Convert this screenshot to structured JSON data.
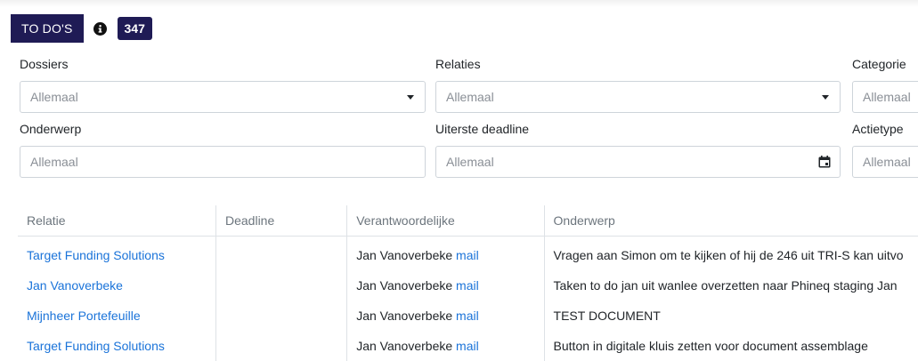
{
  "header": {
    "tab_label": "TO DO'S",
    "info_icon": "info-circle-icon",
    "count": "347",
    "accent": "#1f1b55"
  },
  "filters": {
    "dossiers": {
      "label": "Dossiers",
      "value": "Allemaal"
    },
    "relaties": {
      "label": "Relaties",
      "value": "Allemaal"
    },
    "categorie": {
      "label": "Categorie",
      "value": "Allemaal"
    },
    "onderwerp": {
      "label": "Onderwerp",
      "value": "Allemaal"
    },
    "uiterste_deadline": {
      "label": "Uiterste deadline",
      "value": "Allemaal"
    },
    "actietype": {
      "label": "Actietype",
      "value": "Allemaal"
    }
  },
  "table": {
    "columns": [
      "Relatie",
      "Deadline",
      "Verantwoordelijke",
      "Onderwerp"
    ],
    "rows": [
      {
        "relatie": "Target Funding Solutions",
        "deadline": "",
        "verantwoordelijke": "Jan Vanoverbeke",
        "mail": "mail",
        "onderwerp": "Vragen aan Simon om te kijken of hij de 246 uit TRI-S kan uitvo"
      },
      {
        "relatie": "Jan Vanoverbeke",
        "deadline": "",
        "verantwoordelijke": "Jan Vanoverbeke",
        "mail": "mail",
        "onderwerp": "Taken to do jan uit wanlee overzetten naar Phineq staging Jan"
      },
      {
        "relatie": "Mijnheer Portefeuille",
        "deadline": "",
        "verantwoordelijke": "Jan Vanoverbeke",
        "mail": "mail",
        "onderwerp": "TEST DOCUMENT"
      },
      {
        "relatie": "Target Funding Solutions",
        "deadline": "",
        "verantwoordelijke": "Jan Vanoverbeke",
        "mail": "mail",
        "onderwerp": "Button in digitale kluis zetten voor document assemblage"
      }
    ]
  },
  "colors": {
    "link": "#1a73d9",
    "border": "#ced4da",
    "placeholder": "#8a8f96"
  }
}
